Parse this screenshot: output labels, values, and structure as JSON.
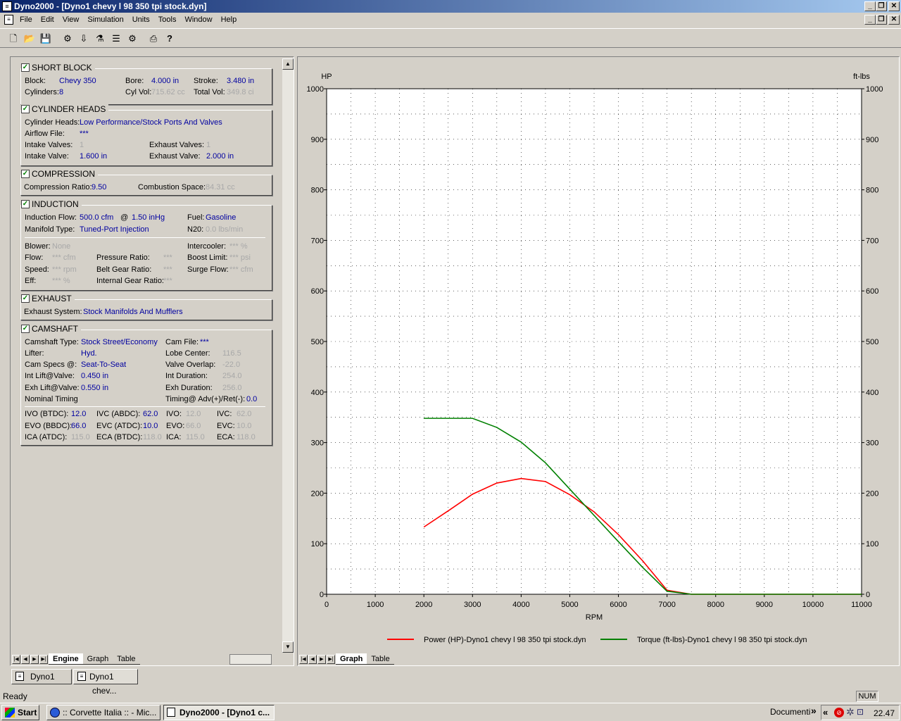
{
  "window": {
    "title": "Dyno2000 - [Dyno1 chevy l 98 350 tpi stock.dyn]"
  },
  "menu": [
    "File",
    "Edit",
    "View",
    "Simulation",
    "Units",
    "Tools",
    "Window",
    "Help"
  ],
  "toolbar_icons": [
    "new-file-icon",
    "open-folder-icon",
    "save-icon",
    "engine-icon",
    "cam-icon",
    "heads-icon",
    "intake-icon",
    "exhaust-icon",
    "print-icon",
    "help-icon"
  ],
  "short_block": {
    "title": "SHORT BLOCK",
    "block_label": "Block:",
    "block": "Chevy 350",
    "bore_label": "Bore:",
    "bore": "4.000 in",
    "stroke_label": "Stroke:",
    "stroke": "3.480 in",
    "cylinders_label": "Cylinders:",
    "cylinders": "8",
    "cylvol_label": "Cyl Vol:",
    "cylvol": "715.62 cc",
    "totalvol_label": "Total Vol:",
    "totalvol": "349.8 ci"
  },
  "cylinder_heads": {
    "title": "CYLINDER HEADS",
    "heads_label": "Cylinder Heads:",
    "heads": "Low Performance/Stock Ports And Valves",
    "airflow_label": "Airflow File:",
    "airflow": "***",
    "intake_valves_label": "Intake Valves:",
    "intake_valves": "1",
    "exhaust_valves_label": "Exhaust Valves:",
    "exhaust_valves": "1",
    "intake_valve_label": "Intake Valve:",
    "intake_valve": "1.600 in",
    "exhaust_valve_label": "Exhaust Valve:",
    "exhaust_valve": "2.000 in"
  },
  "compression": {
    "title": "COMPRESSION",
    "ratio_label": "Compression Ratio:",
    "ratio": "9.50",
    "space_label": "Combustion Space:",
    "space": "84.31 cc"
  },
  "induction": {
    "title": "INDUCTION",
    "flow_label": "Induction Flow:",
    "flow": "500.0 cfm",
    "at": "@",
    "pressure": "1.50 inHg",
    "fuel_label": "Fuel:",
    "fuel": "Gasoline",
    "manifold_label": "Manifold Type:",
    "manifold": "Tuned-Port Injection",
    "n2o_label": "N20:",
    "n2o": "0.0 lbs/min",
    "blower_label": "Blower:",
    "blower": "None",
    "intercooler_label": "Intercooler:",
    "intercooler": "*** %",
    "bflow_label": "Flow:",
    "bflow": "*** cfm",
    "pratio_label": "Pressure Ratio:",
    "pratio": "***",
    "boost_label": "Boost Limit:",
    "boost": "*** psi",
    "speed_label": "Speed:",
    "speed": "*** rpm",
    "belt_label": "Belt Gear Ratio:",
    "belt": "***",
    "surge_label": "Surge Flow:",
    "surge": "*** cfm",
    "eff_label": "Eff:",
    "eff": "*** %",
    "internal_label": "Internal Gear Ratio:",
    "internal": "***"
  },
  "exhaust": {
    "title": "EXHAUST",
    "system_label": "Exhaust System:",
    "system": "Stock Manifolds And Mufflers"
  },
  "camshaft": {
    "title": "CAMSHAFT",
    "type_label": "Camshaft Type:",
    "type": "Stock Street/Economy",
    "file_label": "Cam File:",
    "file": "***",
    "lifter_label": "Lifter:",
    "lifter": "Hyd.",
    "lobe_label": "Lobe Center:",
    "lobe": "116.5",
    "specs_label": "Cam Specs @:",
    "specs": "Seat-To-Seat",
    "overlap_label": "Valve Overlap:",
    "overlap": "-22.0",
    "intlift_label": "Int Lift@Valve:",
    "intlift": "0.450 in",
    "intdur_label": "Int Duration:",
    "intdur": "254.0",
    "exhlift_label": "Exh Lift@Valve:",
    "exhlift": "0.550 in",
    "exhdur_label": "Exh Duration:",
    "exhdur": "256.0",
    "nominal_label": "Nominal Timing",
    "timing_label": "Timing@ Adv(+)/Ret(-):",
    "timing": "0.0",
    "ivo_btdc_label": "IVO (BTDC):",
    "ivo_btdc": "12.0",
    "ivc_abdc_label": "IVC (ABDC):",
    "ivc_abdc": "62.0",
    "ivo_label": "IVO:",
    "ivo": "12.0",
    "ivc_label": "IVC:",
    "ivc": "62.0",
    "evo_bbdc_label": "EVO (BBDC):",
    "evo_bbdc": "66.0",
    "evc_atdc_label": "EVC (ATDC):",
    "evc_atdc": "10.0",
    "evo_label": "EVO:",
    "evo": "66.0",
    "evc_label": "EVC:",
    "evc": "10.0",
    "ica_atdc_label": "ICA (ATDC):",
    "ica_atdc": "115.0",
    "eca_btdc_label": "ECA (BTDC):",
    "eca_btdc": "118.0",
    "ica_label": "ICA:",
    "ica": "115.0",
    "eca_label": "ECA:",
    "eca": "118.0"
  },
  "left_tabs": [
    "Engine",
    "Graph",
    "Table"
  ],
  "right_tabs": [
    "Graph",
    "Table"
  ],
  "doc_tabs": [
    "Dyno1",
    "Dyno1 chev..."
  ],
  "status": {
    "text": "Ready",
    "num": "NUM"
  },
  "taskbar": {
    "start": "Start",
    "items": [
      ":: Corvette Italia :: - Mic...",
      "Dyno2000 - [Dyno1 c..."
    ],
    "documenti": "Documenti",
    "chevrons": "»",
    "tray_chevron": "«",
    "clock": "22.47"
  },
  "chart_data": {
    "type": "line",
    "xlabel": "RPM",
    "ylabel": "HP",
    "y2label": "ft-lbs",
    "xlim": [
      0,
      11000
    ],
    "ylim": [
      0,
      1000
    ],
    "y2lim": [
      0,
      1000
    ],
    "xticks": [
      0,
      1000,
      2000,
      3000,
      4000,
      5000,
      6000,
      7000,
      8000,
      9000,
      10000,
      11000
    ],
    "yticks": [
      0,
      100,
      200,
      300,
      400,
      500,
      600,
      700,
      800,
      900,
      1000
    ],
    "grid": true,
    "legend_position": "bottom",
    "series": [
      {
        "name": "Power (HP)-Dyno1 chevy l 98 350 tpi stock.dyn",
        "color": "#ff0000",
        "x": [
          2000,
          2500,
          3000,
          3500,
          4000,
          4500,
          5000,
          5500,
          6000,
          6500,
          7000,
          7500,
          8000,
          9000,
          10000,
          11000
        ],
        "y": [
          133,
          165,
          198,
          220,
          229,
          223,
          197,
          163,
          118,
          66,
          8,
          0,
          0,
          0,
          0,
          0
        ]
      },
      {
        "name": "Torque (ft-lbs)-Dyno1 chevy l 98 350 tpi stock.dyn",
        "color": "#008000",
        "x": [
          2000,
          2500,
          3000,
          3500,
          4000,
          4500,
          5000,
          5500,
          6000,
          6500,
          7000,
          7500,
          8000,
          9000,
          10000,
          11000
        ],
        "y": [
          348,
          348,
          348,
          330,
          301,
          260,
          208,
          156,
          104,
          53,
          6,
          0,
          0,
          0,
          0,
          0
        ]
      }
    ]
  }
}
